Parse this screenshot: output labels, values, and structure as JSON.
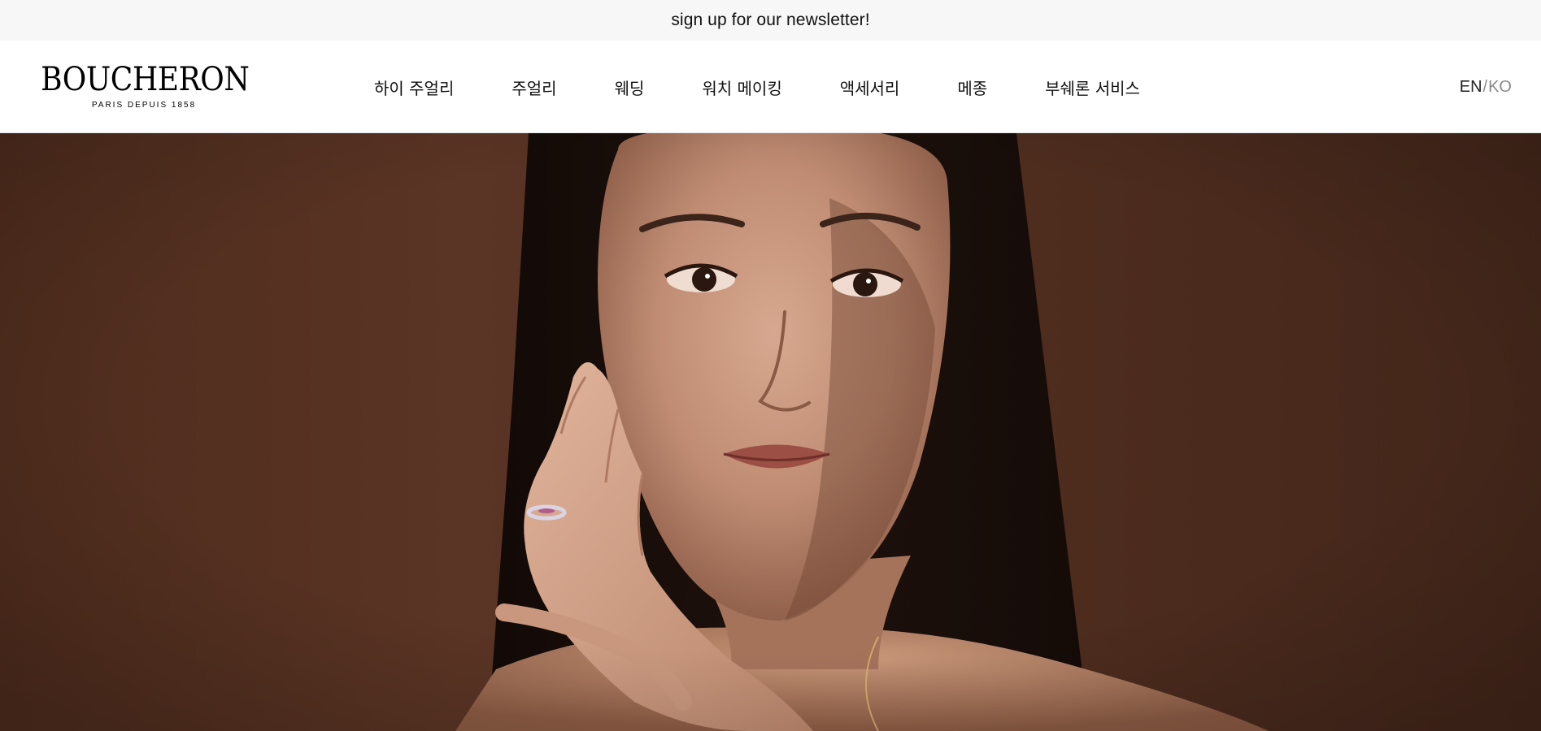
{
  "promo": {
    "newsletter_link": "sign up for our newsletter!"
  },
  "header": {
    "logo": {
      "wordmark": "BOUCHERON",
      "tagline": "PARIS DEPUIS 1858"
    },
    "nav": [
      {
        "label": "하이 주얼리"
      },
      {
        "label": "주얼리"
      },
      {
        "label": "웨딩"
      },
      {
        "label": "워치 메이킹"
      },
      {
        "label": "액세서리"
      },
      {
        "label": "메종"
      },
      {
        "label": "부쉐론 서비스"
      }
    ],
    "language": {
      "en": "EN",
      "separator": "/",
      "ko": "KO",
      "active": "EN"
    }
  },
  "hero": {
    "background_color": "#553222"
  }
}
